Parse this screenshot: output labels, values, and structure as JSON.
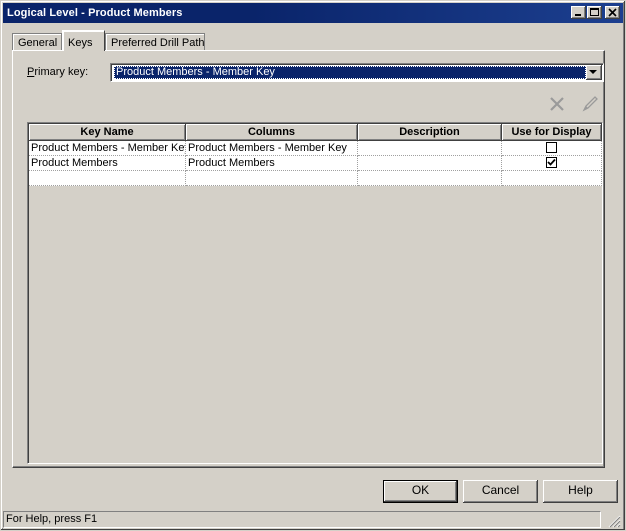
{
  "window": {
    "title": "Logical Level - Product Members"
  },
  "tabs": [
    {
      "label": "General",
      "active": false
    },
    {
      "label": "Keys",
      "active": true
    },
    {
      "label": "Preferred Drill Path",
      "active": false
    }
  ],
  "primary_key": {
    "label_accel": "P",
    "label_rest": "rimary key:",
    "value": "Product Members - Member Key"
  },
  "icons": {
    "delete": "delete-x-icon",
    "edit": "pencil-edit-icon",
    "dropdown": "chevron-down-icon"
  },
  "grid": {
    "columns": [
      "Key Name",
      "Columns",
      "Description",
      "Use for Display"
    ],
    "rows": [
      {
        "key_name": "Product Members - Member Key",
        "columns": "Product Members - Member Key",
        "description": "",
        "use_for_display": false
      },
      {
        "key_name": "Product Members",
        "columns": "Product Members",
        "description": "",
        "use_for_display": true
      },
      {
        "key_name": "",
        "columns": "",
        "description": "",
        "use_for_display": null
      }
    ]
  },
  "buttons": {
    "ok": "OK",
    "cancel": "Cancel",
    "help": "Help"
  },
  "status": {
    "text": "For Help, press F1"
  }
}
